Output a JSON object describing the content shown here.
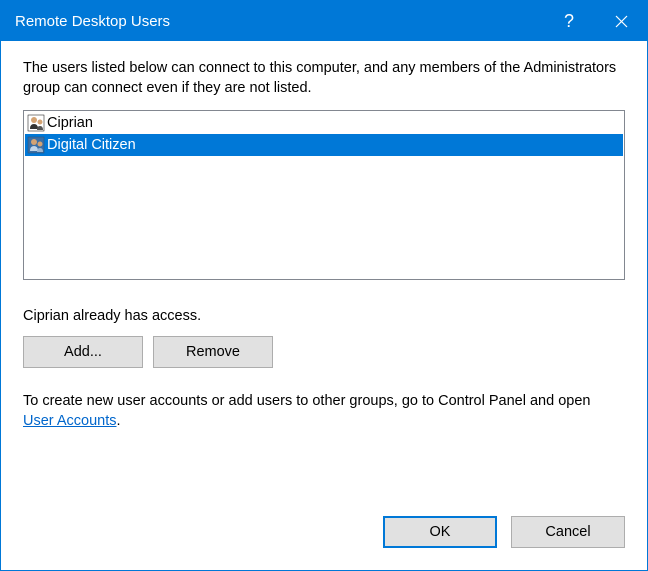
{
  "titlebar": {
    "title": "Remote Desktop Users"
  },
  "description": "The users listed below can connect to this computer, and any members of the Administrators group can connect even if they are not listed.",
  "users": [
    {
      "name": "Ciprian",
      "selected": false
    },
    {
      "name": "Digital Citizen",
      "selected": true
    }
  ],
  "access_note": "Ciprian already has access.",
  "buttons": {
    "add": "Add...",
    "remove": "Remove",
    "ok": "OK",
    "cancel": "Cancel"
  },
  "hint": {
    "prefix": "To create new user accounts or add users to other groups, go to Control Panel and open ",
    "link": "User Accounts",
    "suffix": "."
  }
}
